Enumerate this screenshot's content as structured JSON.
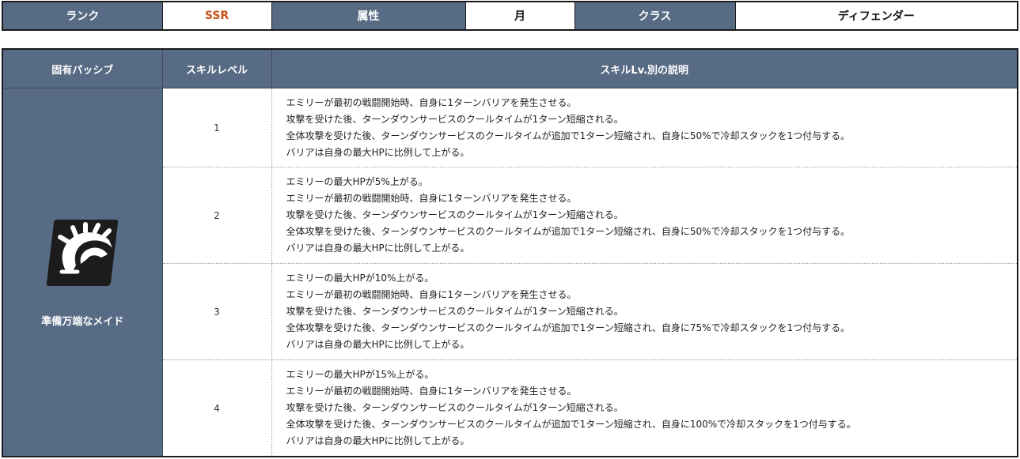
{
  "info": {
    "rank_label": "ランク",
    "rank_value": "SSR",
    "attribute_label": "属性",
    "attribute_value": "月",
    "class_label": "クラス",
    "class_value": "ディフェンダー",
    "rank_color": "#c5541c"
  },
  "skill_table": {
    "col_passive": "固有パッシブ",
    "col_level": "スキルレベル",
    "col_description": "スキルLv.別の説明",
    "skill_name": "準備万端なメイド",
    "skill_icon": "fan-shield-icon",
    "header_color": "#586b85",
    "rows": [
      {
        "level": "1",
        "lines": [
          "エミリーが最初の戦闘開始時、自身に1ターンバリアを発生させる。",
          "攻撃を受けた後、ターンダウンサービスのクールタイムが1ターン短縮される。",
          "全体攻撃を受けた後、ターンダウンサービスのクールタイムが追加で1ターン短縮され、自身に50%で冷却スタックを1つ付与する。",
          "バリアは自身の最大HPに比例して上がる。"
        ]
      },
      {
        "level": "2",
        "lines": [
          "エミリーの最大HPが5%上がる。",
          "エミリーが最初の戦闘開始時、自身に1ターンバリアを発生させる。",
          "攻撃を受けた後、ターンダウンサービスのクールタイムが1ターン短縮される。",
          "全体攻撃を受けた後、ターンダウンサービスのクールタイムが追加で1ターン短縮され、自身に50%で冷却スタックを1つ付与する。",
          "バリアは自身の最大HPに比例して上がる。"
        ]
      },
      {
        "level": "3",
        "lines": [
          "エミリーの最大HPが10%上がる。",
          "エミリーが最初の戦闘開始時、自身に1ターンバリアを発生させる。",
          "攻撃を受けた後、ターンダウンサービスのクールタイムが1ターン短縮される。",
          "全体攻撃を受けた後、ターンダウンサービスのクールタイムが追加で1ターン短縮され、自身に75%で冷却スタックを1つ付与する。",
          "バリアは自身の最大HPに比例して上がる。"
        ]
      },
      {
        "level": "4",
        "lines": [
          "エミリーの最大HPが15%上がる。",
          "エミリーが最初の戦闘開始時、自身に1ターンバリアを発生させる。",
          "攻撃を受けた後、ターンダウンサービスのクールタイムが1ターン短縮される。",
          "全体攻撃を受けた後、ターンダウンサービスのクールタイムが追加で1ターン短縮され、自身に100%で冷却スタックを1つ付与する。",
          "バリアは自身の最大HPに比例して上がる。"
        ]
      }
    ]
  }
}
